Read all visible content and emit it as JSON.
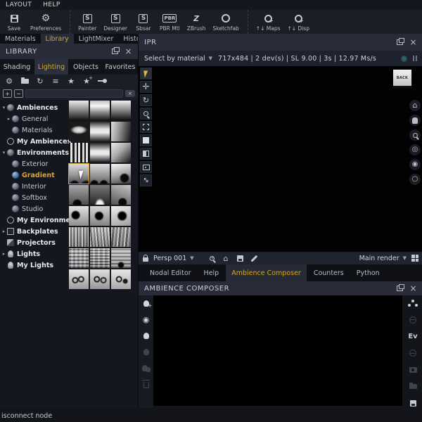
{
  "menubar": {
    "items": [
      {
        "label": "LAYOUT"
      },
      {
        "label": "HELP"
      }
    ]
  },
  "toolbar": {
    "items": [
      {
        "name": "save",
        "label": "Save",
        "kind": "disk",
        "glyph": ""
      },
      {
        "name": "preferences",
        "label": "Preferences",
        "kind": "gear",
        "glyph": "⚙",
        "sep": true
      },
      {
        "name": "painter",
        "label": "Painter",
        "kind": "sub",
        "glyph": "S"
      },
      {
        "name": "designer",
        "label": "Designer",
        "kind": "sub",
        "glyph": "S"
      },
      {
        "name": "sbsar",
        "label": "Sbsar",
        "kind": "sub",
        "glyph": "S"
      },
      {
        "name": "pbr-mtl",
        "label": "PBR Mtl",
        "kind": "pbr",
        "glyph": "PBR"
      },
      {
        "name": "zbrush",
        "label": "ZBrush",
        "kind": "zb",
        "glyph": "Z"
      },
      {
        "name": "sketchfab",
        "label": "Sketchfab",
        "kind": "ring",
        "glyph": "",
        "sep": true
      },
      {
        "name": "sync-maps",
        "label": "↑↓ Maps",
        "kind": "sync",
        "glyph": ""
      },
      {
        "name": "sync-disp",
        "label": "↑↓ Disp",
        "kind": "sync",
        "glyph": ""
      }
    ]
  },
  "doc_tabs": [
    {
      "label": "Materials"
    },
    {
      "label": "Library",
      "active": true
    },
    {
      "label": "LightMixer"
    },
    {
      "label": "History"
    }
  ],
  "library": {
    "title": "LIBRARY",
    "tabs": [
      {
        "label": "Shading"
      },
      {
        "label": "Lighting",
        "active": true
      },
      {
        "label": "Objects"
      },
      {
        "label": "Favorites"
      }
    ],
    "actions": [
      {
        "name": "settings",
        "kind": "gear",
        "glyph": "⚙"
      },
      {
        "name": "folder",
        "kind": "folder",
        "glyph": ""
      },
      {
        "name": "refresh",
        "kind": "refresh",
        "glyph": "↻"
      },
      {
        "name": "list-view",
        "kind": "list",
        "glyph": "≡"
      },
      {
        "name": "favorite",
        "kind": "star",
        "glyph": "★"
      },
      {
        "name": "favorite-add",
        "kind": "staradd",
        "glyph": "★"
      },
      {
        "name": "size-slider",
        "kind": "slider",
        "glyph": ""
      }
    ],
    "filter": {
      "collapse_glyph": "+",
      "expand_glyph": "−",
      "value": ""
    },
    "tree": [
      {
        "label": "Ambiences",
        "arrow": "▾",
        "bold": true,
        "icon": "amb"
      },
      {
        "label": "General",
        "arrow": "▸",
        "level": 1,
        "icon": "amb"
      },
      {
        "label": "Materials",
        "arrow": "",
        "level": 1,
        "icon": "amb"
      },
      {
        "label": "My Ambiences",
        "arrow": "",
        "bold": true,
        "icon": "globe"
      },
      {
        "label": "Environments",
        "arrow": "▾",
        "bold": true,
        "icon": "amb"
      },
      {
        "label": "Exterior",
        "arrow": "",
        "level": 1,
        "icon": "amb"
      },
      {
        "label": "Gradient",
        "arrow": "",
        "level": 1,
        "icon": "amb",
        "selected": true
      },
      {
        "label": "Interior",
        "arrow": "",
        "level": 1,
        "icon": "amb"
      },
      {
        "label": "Softbox",
        "arrow": "",
        "level": 1,
        "icon": "amb"
      },
      {
        "label": "Studio",
        "arrow": "",
        "level": 1,
        "icon": "amb"
      },
      {
        "label": "My Environments",
        "arrow": "",
        "bold": true,
        "icon": "globe"
      },
      {
        "label": "Backplates",
        "arrow": "▸",
        "bold": true,
        "icon": "img"
      },
      {
        "label": "Projectors",
        "arrow": "",
        "bold": true,
        "icon": "proj"
      },
      {
        "label": "Lights",
        "arrow": "▸",
        "bold": true,
        "icon": "bulb"
      },
      {
        "label": "My Lights",
        "arrow": "",
        "bold": true,
        "icon": "bulb"
      }
    ],
    "thumbnails": [
      {
        "bg": "linear-gradient(180deg,#ededed 0%,#9b9b9b 40%,#121212 100%)"
      },
      {
        "bg": "linear-gradient(180deg,#c2c2c2 0%,#f5f5f5 28%,#8a8a8a 60%,#161616 100%)"
      },
      {
        "bg": "linear-gradient(180deg,#f2f2f2 0%,#8f8f8f 45%,#0f0f0f 100%)"
      },
      {
        "bg": "radial-gradient(ellipse 55% 28% at 50% 42%,#f0f0f0 0%,#c2c2c2 45%,#1b1b1b 78%)"
      },
      {
        "bg": "linear-gradient(180deg,#2b2b2b 0%,#e3e3e3 38%,#efefef 55%,#1d1d1d 100%)"
      },
      {
        "bg": "linear-gradient(100deg,#e0e0e0 0%,#8d8d8d 45%,#141414 100%)"
      },
      {
        "bg": "repeating-linear-gradient(90deg,#111 0 2px,#e4e4e4 2px 5px,#161616 5px 8px,#d8d8d8 8px 11px)"
      },
      {
        "bg": "linear-gradient(180deg,#202020 0%,#e9e9e9 42%,#e9e9e9 58%,#141414 100%)"
      },
      {
        "bg": "linear-gradient(135deg,#ececec 0%,#a8a8a8 45%,#161616 100%)"
      },
      {
        "bg": "radial-gradient(circle 10px at 28% 108%,#070707 55%,rgba(7,7,7,0) 75%),radial-gradient(circle 12px at 88% 112%,#0c0c0c 50%,rgba(12,12,12,0) 72%),linear-gradient(180deg,#d8d8d8 0%,#9a9a9a 55%,#4a4a4a 100%)",
        "selected": true
      },
      {
        "bg": "radial-gradient(circle 9px at 22% 102%,#060606 50%,rgba(6,6,6,0) 70%),radial-gradient(circle 9px at 70% 102%,#090909 50%,rgba(9,9,9,0) 70%),linear-gradient(180deg,#dedede 0%,#8a8a8a 70%,#5a5a5a 100%)"
      },
      {
        "bg": "radial-gradient(circle 11px at 68% 72%,#0a0a0a 45%,rgba(10,10,10,0) 68%),linear-gradient(165deg,#f0f0f0 5%,#a2a2a2 55%,#3f3f3f 100%)"
      },
      {
        "bg": "radial-gradient(circle 10px at 42% 96%,#050505 50%,rgba(5,5,5,0) 72%),linear-gradient(180deg,#a8a8a8 0%,#4e4e4e 100%)"
      },
      {
        "bg": "radial-gradient(ellipse 36% 50% at 50% 104%,#f2f2f2 45%,rgba(242,242,242,0) 75%),linear-gradient(180deg,#787878 0%,#262626 100%)"
      },
      {
        "bg": "radial-gradient(circle 10px at 58% 88%,#090909 48%,rgba(9,9,9,0) 70%),linear-gradient(200deg,#c4c4c4 0%,#545454 100%)"
      },
      {
        "bg": "radial-gradient(circle 8px at 34% 46%,#000 60%,rgba(0,0,0,0) 88%),linear-gradient(180deg,#e2e2e2 0%,#8e8e8e 100%)"
      },
      {
        "bg": "radial-gradient(circle 8px at 46% 50%,#000 60%,rgba(0,0,0,0) 88%),linear-gradient(180deg,#d6d6d6 0%,#828282 100%)"
      },
      {
        "bg": "radial-gradient(circle 9px at 56% 50%,#000 55%,rgba(0,0,0,0) 86%),linear-gradient(160deg,#f0f0f0 0%,#9e9e9e 100%)"
      },
      {
        "bg": "repeating-linear-gradient(90deg,rgba(255,255,255,.5) 0 2px,rgba(0,0,0,.4) 2px 4px,rgba(255,255,255,.2) 4px 6px,rgba(0,0,0,.25) 6px 9px),linear-gradient(180deg,#bdbdbd,#7d7d7d)"
      },
      {
        "bg": "repeating-linear-gradient(85deg,rgba(255,255,255,.5) 0 2px,rgba(0,0,0,.4) 2px 4px,rgba(255,255,255,.2) 4px 7px,rgba(0,0,0,.25) 7px 9px),linear-gradient(180deg,#c4c4c4,#777)"
      },
      {
        "bg": "repeating-linear-gradient(95deg,rgba(255,255,255,.5) 0 2px,rgba(0,0,0,.4) 2px 5px,rgba(255,255,255,.2) 5px 7px,rgba(0,0,0,.25) 7px 10px),linear-gradient(180deg,#b5b5b5,#828282)"
      },
      {
        "bg": "repeating-linear-gradient(0deg,rgba(0,0,0,.3) 0 2px,rgba(255,255,255,.35) 2px 5px),repeating-linear-gradient(90deg,rgba(0,0,0,.2) 0 3px,rgba(255,255,255,.25) 3px 6px),linear-gradient(180deg,#b5b5b5,#6e6e6e)"
      },
      {
        "bg": "repeating-linear-gradient(0deg,rgba(0,0,0,.28) 0 2px,rgba(255,255,255,.35) 2px 4px),repeating-linear-gradient(90deg,rgba(0,0,0,.22) 0 4px,rgba(255,255,255,.25) 4px 7px),linear-gradient(180deg,#bcbcbc,#707070)"
      },
      {
        "bg": "radial-gradient(circle 7px at 50% 85%,#0a0a0a 45%,rgba(0,0,0,0) 75%),repeating-linear-gradient(0deg,rgba(0,0,0,.25) 0 2px,rgba(255,255,255,.3) 2px 5px),linear-gradient(180deg,#c2c2c2,#7a7a7a)"
      },
      {
        "bg": "radial-gradient(circle at 32% 55%,rgba(0,0,0,0) 2px,#222 3px 4px,rgba(0,0,0,0) 5px),radial-gradient(circle at 62% 50%,rgba(0,0,0,0) 2px,#262626 3px 4px,rgba(0,0,0,0) 5px),linear-gradient(180deg,#e6e6e6,#9c9c9c)"
      },
      {
        "bg": "radial-gradient(circle at 35% 50%,rgba(0,0,0,0) 2px,#1e1e1e 3px 4px,rgba(0,0,0,0) 5px),radial-gradient(circle at 68% 55%,rgba(0,0,0,0) 2px,#2a2a2a 3px 4px,rgba(0,0,0,0) 5px),linear-gradient(180deg,#dedede,#969696)"
      },
      {
        "bg": "radial-gradient(circle at 40% 50%,rgba(0,0,0,0) 2px,#222 3px 4px,rgba(0,0,0,0) 5px),radial-gradient(circle 6px at 72% 60%,#1a1a1a 45%,rgba(0,0,0,0) 70%),linear-gradient(180deg,#e8e8e8,#a8a8a8)"
      }
    ]
  },
  "ipr": {
    "title": "IPR",
    "select_mode": "Select by material",
    "status": "717x484  |  2 dev(s)  |  SL 9.00  |  3s  |  12.97 Ms/s",
    "back_card": "BACK",
    "camera": "Persp 001",
    "render_target": "Main render",
    "tools": [
      {
        "name": "select-tool",
        "kind": "cursor",
        "glyph": "",
        "active": true
      },
      {
        "name": "pan-tool",
        "kind": "move",
        "glyph": "✛"
      },
      {
        "name": "orbit-tool",
        "kind": "orbit",
        "glyph": "↻"
      },
      {
        "name": "zoom-tool",
        "kind": "mag",
        "glyph": ""
      },
      {
        "name": "region-render-tool",
        "kind": "region",
        "glyph": ""
      },
      {
        "name": "backplate-tool",
        "kind": "square",
        "glyph": ""
      },
      {
        "name": "material-override-tool",
        "kind": "square2",
        "glyph": ""
      },
      {
        "name": "snapshot-tool",
        "kind": "imgico",
        "glyph": ""
      },
      {
        "name": "fullscreen-tool",
        "kind": "expand",
        "glyph": "↔"
      }
    ],
    "nav": [
      {
        "name": "home-view",
        "kind": "home"
      },
      {
        "name": "pan-view",
        "kind": "hand"
      },
      {
        "name": "zoom-view",
        "kind": "mag"
      },
      {
        "name": "focus-view",
        "kind": "focus"
      },
      {
        "name": "target-view",
        "kind": "target"
      },
      {
        "name": "orbit-view",
        "kind": "dot"
      }
    ],
    "viewbar_tools": [
      {
        "name": "frame-region",
        "kind": "magplus"
      },
      {
        "name": "home-camera",
        "kind": "home"
      },
      {
        "name": "save-camera",
        "kind": "disk"
      },
      {
        "name": "edit-camera",
        "kind": "pencil"
      }
    ]
  },
  "bottom_tabs": [
    {
      "label": "Nodal Editor"
    },
    {
      "label": "Help"
    },
    {
      "label": "Ambience Composer",
      "active": true
    },
    {
      "label": "Counters"
    },
    {
      "label": "Python"
    }
  ],
  "composer": {
    "title": "AMBIENCE COMPOSER",
    "tools": [
      {
        "name": "add-light",
        "kind": "bulbplus"
      },
      {
        "name": "add-dome",
        "kind": "dome"
      },
      {
        "name": "light-item",
        "kind": "bulb"
      },
      {
        "name": "light-item-2",
        "kind": "bulb",
        "dim": true
      },
      {
        "name": "light-group",
        "kind": "bulbs",
        "dim": true
      },
      {
        "name": "delete-light",
        "kind": "trash",
        "dim": true
      }
    ]
  },
  "right_dock": [
    {
      "name": "node-graph",
      "kind": "nodes",
      "label": ""
    },
    {
      "name": "environment-globe",
      "kind": "globe",
      "label": "",
      "dim": true
    },
    {
      "name": "exposure-ev",
      "kind": "txt",
      "label": "Ev"
    },
    {
      "name": "world-globe",
      "kind": "globe",
      "label": "",
      "dim": true
    },
    {
      "name": "camera-panel",
      "kind": "cam",
      "label": "",
      "dim": true
    },
    {
      "name": "open-folder",
      "kind": "folder",
      "label": "",
      "dim": true
    },
    {
      "name": "save-file",
      "kind": "disk",
      "label": "",
      "dim": true
    }
  ],
  "statusbar": {
    "text": "isconnect node"
  }
}
